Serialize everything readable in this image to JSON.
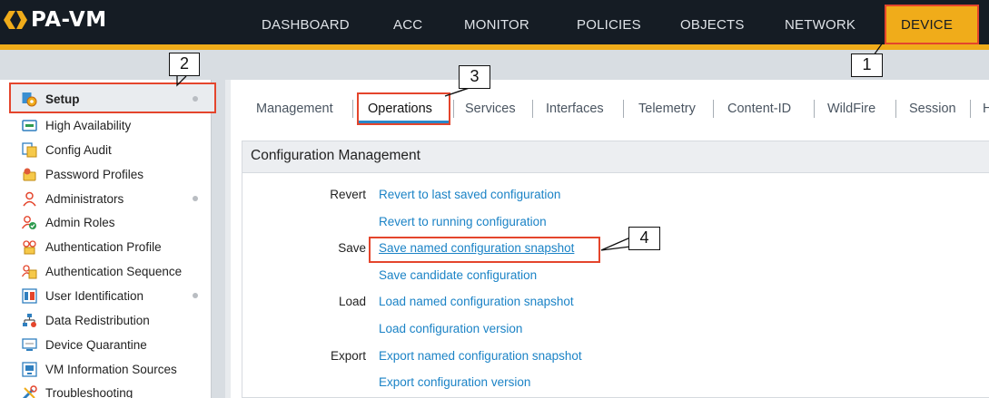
{
  "app": {
    "logo_text": "PA-VM"
  },
  "nav": {
    "tabs": [
      "DASHBOARD",
      "ACC",
      "MONITOR",
      "POLICIES",
      "OBJECTS",
      "NETWORK",
      "DEVICE"
    ],
    "active": "DEVICE"
  },
  "sidebar": {
    "items": [
      {
        "label": "Setup",
        "icon": "setup-gear-icon",
        "dot": true,
        "selected": true
      },
      {
        "label": "High Availability",
        "icon": "high-availability-icon",
        "dot": false
      },
      {
        "label": "Config Audit",
        "icon": "config-audit-icon",
        "dot": false
      },
      {
        "label": "Password Profiles",
        "icon": "password-profiles-icon",
        "dot": false
      },
      {
        "label": "Administrators",
        "icon": "administrator-user-icon",
        "dot": true
      },
      {
        "label": "Admin Roles",
        "icon": "admin-roles-icon",
        "dot": false
      },
      {
        "label": "Authentication Profile",
        "icon": "authentication-profile-icon",
        "dot": false
      },
      {
        "label": "Authentication Sequence",
        "icon": "authentication-sequence-icon",
        "dot": false
      },
      {
        "label": "User Identification",
        "icon": "user-identification-icon",
        "dot": true
      },
      {
        "label": "Data Redistribution",
        "icon": "data-redistribution-icon",
        "dot": false
      },
      {
        "label": "Device Quarantine",
        "icon": "device-quarantine-icon",
        "dot": false
      },
      {
        "label": "VM Information Sources",
        "icon": "vm-information-sources-icon",
        "dot": false
      },
      {
        "label": "Troubleshooting",
        "icon": "troubleshooting-icon",
        "dot": false
      }
    ]
  },
  "subtabs": {
    "items": [
      "Management",
      "Operations",
      "Services",
      "Interfaces",
      "Telemetry",
      "Content-ID",
      "WildFire",
      "Session",
      "H"
    ],
    "active": "Operations"
  },
  "config_panel": {
    "title": "Configuration Management",
    "rows": [
      {
        "label": "Revert",
        "link": "Revert to last saved configuration"
      },
      {
        "label": "",
        "link": "Revert to running configuration"
      },
      {
        "label": "Save",
        "link": "Save named configuration snapshot"
      },
      {
        "label": "",
        "link": "Save candidate configuration"
      },
      {
        "label": "Load",
        "link": "Load named configuration snapshot"
      },
      {
        "label": "",
        "link": "Load configuration version"
      },
      {
        "label": "Export",
        "link": "Export named configuration snapshot"
      },
      {
        "label": "",
        "link": "Export configuration version"
      }
    ]
  },
  "callouts": [
    "1",
    "2",
    "3",
    "4"
  ],
  "colors": {
    "accent": "#f0ac1a",
    "highlight": "#e4452c",
    "link": "#1b83c6",
    "topbar": "#151c24"
  }
}
